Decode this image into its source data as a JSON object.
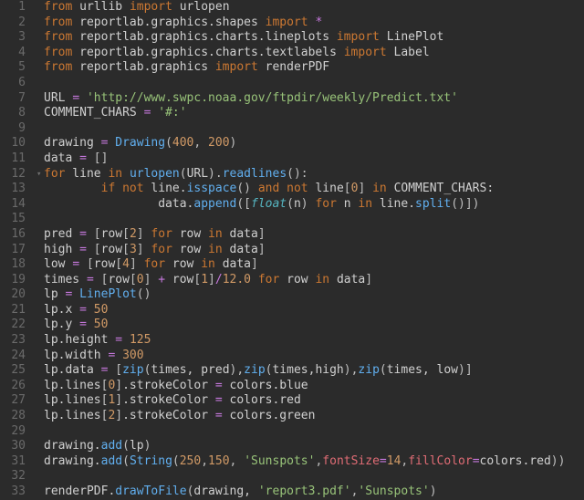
{
  "lines": [
    {
      "n": "1",
      "fold": "",
      "tokens": [
        {
          "c": "kw",
          "t": "from"
        },
        {
          "c": "id",
          "t": " urllib "
        },
        {
          "c": "kw",
          "t": "import"
        },
        {
          "c": "id",
          "t": " urlopen"
        }
      ]
    },
    {
      "n": "2",
      "fold": "",
      "tokens": [
        {
          "c": "kw",
          "t": "from"
        },
        {
          "c": "id",
          "t": " reportlab.graphics.shapes "
        },
        {
          "c": "kw",
          "t": "import"
        },
        {
          "c": "id",
          "t": " "
        },
        {
          "c": "op",
          "t": "*"
        }
      ]
    },
    {
      "n": "3",
      "fold": "",
      "tokens": [
        {
          "c": "kw",
          "t": "from"
        },
        {
          "c": "id",
          "t": " reportlab.graphics.charts.lineplots "
        },
        {
          "c": "kw",
          "t": "import"
        },
        {
          "c": "id",
          "t": " LinePlot"
        }
      ]
    },
    {
      "n": "4",
      "fold": "",
      "tokens": [
        {
          "c": "kw",
          "t": "from"
        },
        {
          "c": "id",
          "t": " reportlab.graphics.charts.textlabels "
        },
        {
          "c": "kw",
          "t": "import"
        },
        {
          "c": "id",
          "t": " Label"
        }
      ]
    },
    {
      "n": "5",
      "fold": "",
      "tokens": [
        {
          "c": "kw",
          "t": "from"
        },
        {
          "c": "id",
          "t": " reportlab.graphics "
        },
        {
          "c": "kw",
          "t": "import"
        },
        {
          "c": "id",
          "t": " renderPDF"
        }
      ]
    },
    {
      "n": "6",
      "fold": "",
      "tokens": [
        {
          "c": "id",
          "t": ""
        }
      ]
    },
    {
      "n": "7",
      "fold": "",
      "tokens": [
        {
          "c": "id",
          "t": "URL "
        },
        {
          "c": "op",
          "t": "="
        },
        {
          "c": "id",
          "t": " "
        },
        {
          "c": "str",
          "t": "'http://www.swpc.noaa.gov/ftpdir/weekly/Predict.txt'"
        }
      ]
    },
    {
      "n": "8",
      "fold": "",
      "tokens": [
        {
          "c": "id",
          "t": "COMMENT_CHARS "
        },
        {
          "c": "op",
          "t": "="
        },
        {
          "c": "id",
          "t": " "
        },
        {
          "c": "str",
          "t": "'#:'"
        }
      ]
    },
    {
      "n": "9",
      "fold": "",
      "tokens": [
        {
          "c": "id",
          "t": ""
        }
      ]
    },
    {
      "n": "10",
      "fold": "",
      "tokens": [
        {
          "c": "id",
          "t": "drawing "
        },
        {
          "c": "op",
          "t": "="
        },
        {
          "c": "id",
          "t": " "
        },
        {
          "c": "fn",
          "t": "Drawing"
        },
        {
          "c": "pun",
          "t": "("
        },
        {
          "c": "num",
          "t": "400"
        },
        {
          "c": "pun",
          "t": ", "
        },
        {
          "c": "num",
          "t": "200"
        },
        {
          "c": "pun",
          "t": ")"
        }
      ]
    },
    {
      "n": "11",
      "fold": "",
      "tokens": [
        {
          "c": "id",
          "t": "data "
        },
        {
          "c": "op",
          "t": "="
        },
        {
          "c": "id",
          "t": " "
        },
        {
          "c": "pun",
          "t": "[]"
        }
      ]
    },
    {
      "n": "12",
      "fold": "▾",
      "tokens": [
        {
          "c": "kw",
          "t": "for"
        },
        {
          "c": "id",
          "t": " line "
        },
        {
          "c": "kw",
          "t": "in"
        },
        {
          "c": "id",
          "t": " "
        },
        {
          "c": "fn",
          "t": "urlopen"
        },
        {
          "c": "pun",
          "t": "("
        },
        {
          "c": "id",
          "t": "URL"
        },
        {
          "c": "pun",
          "t": ")."
        },
        {
          "c": "fn",
          "t": "readlines"
        },
        {
          "c": "pun",
          "t": "():"
        }
      ]
    },
    {
      "n": "13",
      "fold": "",
      "tokens": [
        {
          "c": "id",
          "t": "        "
        },
        {
          "c": "kw",
          "t": "if not"
        },
        {
          "c": "id",
          "t": " line."
        },
        {
          "c": "fn",
          "t": "isspace"
        },
        {
          "c": "pun",
          "t": "()"
        },
        {
          "c": "id",
          "t": " "
        },
        {
          "c": "kw",
          "t": "and not"
        },
        {
          "c": "id",
          "t": " line"
        },
        {
          "c": "pun",
          "t": "["
        },
        {
          "c": "num",
          "t": "0"
        },
        {
          "c": "pun",
          "t": "]"
        },
        {
          "c": "id",
          "t": " "
        },
        {
          "c": "kw",
          "t": "in"
        },
        {
          "c": "id",
          "t": " COMMENT_CHARS:"
        }
      ]
    },
    {
      "n": "14",
      "fold": "",
      "tokens": [
        {
          "c": "id",
          "t": "                data."
        },
        {
          "c": "fn",
          "t": "append"
        },
        {
          "c": "pun",
          "t": "(["
        },
        {
          "c": "fni",
          "t": "float"
        },
        {
          "c": "pun",
          "t": "("
        },
        {
          "c": "id",
          "t": "n"
        },
        {
          "c": "pun",
          "t": ")"
        },
        {
          "c": "id",
          "t": " "
        },
        {
          "c": "kw",
          "t": "for"
        },
        {
          "c": "id",
          "t": " n "
        },
        {
          "c": "kw",
          "t": "in"
        },
        {
          "c": "id",
          "t": " line."
        },
        {
          "c": "fn",
          "t": "split"
        },
        {
          "c": "pun",
          "t": "()])"
        }
      ]
    },
    {
      "n": "15",
      "fold": "",
      "tokens": [
        {
          "c": "id",
          "t": ""
        }
      ]
    },
    {
      "n": "16",
      "fold": "",
      "tokens": [
        {
          "c": "id",
          "t": "pred "
        },
        {
          "c": "op",
          "t": "="
        },
        {
          "c": "id",
          "t": " "
        },
        {
          "c": "pun",
          "t": "["
        },
        {
          "c": "id",
          "t": "row"
        },
        {
          "c": "pun",
          "t": "["
        },
        {
          "c": "num",
          "t": "2"
        },
        {
          "c": "pun",
          "t": "]"
        },
        {
          "c": "id",
          "t": " "
        },
        {
          "c": "kw",
          "t": "for"
        },
        {
          "c": "id",
          "t": " row "
        },
        {
          "c": "kw",
          "t": "in"
        },
        {
          "c": "id",
          "t": " data"
        },
        {
          "c": "pun",
          "t": "]"
        }
      ]
    },
    {
      "n": "17",
      "fold": "",
      "tokens": [
        {
          "c": "id",
          "t": "high "
        },
        {
          "c": "op",
          "t": "="
        },
        {
          "c": "id",
          "t": " "
        },
        {
          "c": "pun",
          "t": "["
        },
        {
          "c": "id",
          "t": "row"
        },
        {
          "c": "pun",
          "t": "["
        },
        {
          "c": "num",
          "t": "3"
        },
        {
          "c": "pun",
          "t": "]"
        },
        {
          "c": "id",
          "t": " "
        },
        {
          "c": "kw",
          "t": "for"
        },
        {
          "c": "id",
          "t": " row "
        },
        {
          "c": "kw",
          "t": "in"
        },
        {
          "c": "id",
          "t": " data"
        },
        {
          "c": "pun",
          "t": "]"
        }
      ]
    },
    {
      "n": "18",
      "fold": "",
      "tokens": [
        {
          "c": "id",
          "t": "low "
        },
        {
          "c": "op",
          "t": "="
        },
        {
          "c": "id",
          "t": " "
        },
        {
          "c": "pun",
          "t": "["
        },
        {
          "c": "id",
          "t": "row"
        },
        {
          "c": "pun",
          "t": "["
        },
        {
          "c": "num",
          "t": "4"
        },
        {
          "c": "pun",
          "t": "]"
        },
        {
          "c": "id",
          "t": " "
        },
        {
          "c": "kw",
          "t": "for"
        },
        {
          "c": "id",
          "t": " row "
        },
        {
          "c": "kw",
          "t": "in"
        },
        {
          "c": "id",
          "t": " data"
        },
        {
          "c": "pun",
          "t": "]"
        }
      ]
    },
    {
      "n": "19",
      "fold": "",
      "tokens": [
        {
          "c": "id",
          "t": "times "
        },
        {
          "c": "op",
          "t": "="
        },
        {
          "c": "id",
          "t": " "
        },
        {
          "c": "pun",
          "t": "["
        },
        {
          "c": "id",
          "t": "row"
        },
        {
          "c": "pun",
          "t": "["
        },
        {
          "c": "num",
          "t": "0"
        },
        {
          "c": "pun",
          "t": "]"
        },
        {
          "c": "id",
          "t": " "
        },
        {
          "c": "op",
          "t": "+"
        },
        {
          "c": "id",
          "t": " row"
        },
        {
          "c": "pun",
          "t": "["
        },
        {
          "c": "num",
          "t": "1"
        },
        {
          "c": "pun",
          "t": "]"
        },
        {
          "c": "op",
          "t": "/"
        },
        {
          "c": "num",
          "t": "12.0"
        },
        {
          "c": "id",
          "t": " "
        },
        {
          "c": "kw",
          "t": "for"
        },
        {
          "c": "id",
          "t": " row "
        },
        {
          "c": "kw",
          "t": "in"
        },
        {
          "c": "id",
          "t": " data"
        },
        {
          "c": "pun",
          "t": "]"
        }
      ]
    },
    {
      "n": "20",
      "fold": "",
      "tokens": [
        {
          "c": "id",
          "t": "lp "
        },
        {
          "c": "op",
          "t": "="
        },
        {
          "c": "id",
          "t": " "
        },
        {
          "c": "fn",
          "t": "LinePlot"
        },
        {
          "c": "pun",
          "t": "()"
        }
      ]
    },
    {
      "n": "21",
      "fold": "",
      "tokens": [
        {
          "c": "id",
          "t": "lp.x "
        },
        {
          "c": "op",
          "t": "="
        },
        {
          "c": "id",
          "t": " "
        },
        {
          "c": "num",
          "t": "50"
        }
      ]
    },
    {
      "n": "22",
      "fold": "",
      "tokens": [
        {
          "c": "id",
          "t": "lp.y "
        },
        {
          "c": "op",
          "t": "="
        },
        {
          "c": "id",
          "t": " "
        },
        {
          "c": "num",
          "t": "50"
        }
      ]
    },
    {
      "n": "23",
      "fold": "",
      "tokens": [
        {
          "c": "id",
          "t": "lp.height "
        },
        {
          "c": "op",
          "t": "="
        },
        {
          "c": "id",
          "t": " "
        },
        {
          "c": "num",
          "t": "125"
        }
      ]
    },
    {
      "n": "24",
      "fold": "",
      "tokens": [
        {
          "c": "id",
          "t": "lp.width "
        },
        {
          "c": "op",
          "t": "="
        },
        {
          "c": "id",
          "t": " "
        },
        {
          "c": "num",
          "t": "300"
        }
      ]
    },
    {
      "n": "25",
      "fold": "",
      "tokens": [
        {
          "c": "id",
          "t": "lp.data "
        },
        {
          "c": "op",
          "t": "="
        },
        {
          "c": "id",
          "t": " "
        },
        {
          "c": "pun",
          "t": "["
        },
        {
          "c": "fn",
          "t": "zip"
        },
        {
          "c": "pun",
          "t": "("
        },
        {
          "c": "id",
          "t": "times, pred"
        },
        {
          "c": "pun",
          "t": "),"
        },
        {
          "c": "fn",
          "t": "zip"
        },
        {
          "c": "pun",
          "t": "("
        },
        {
          "c": "id",
          "t": "times,high"
        },
        {
          "c": "pun",
          "t": "),"
        },
        {
          "c": "fn",
          "t": "zip"
        },
        {
          "c": "pun",
          "t": "("
        },
        {
          "c": "id",
          "t": "times, low"
        },
        {
          "c": "pun",
          "t": ")]"
        }
      ]
    },
    {
      "n": "26",
      "fold": "",
      "tokens": [
        {
          "c": "id",
          "t": "lp.lines"
        },
        {
          "c": "pun",
          "t": "["
        },
        {
          "c": "num",
          "t": "0"
        },
        {
          "c": "pun",
          "t": "]"
        },
        {
          "c": "id",
          "t": ".strokeColor "
        },
        {
          "c": "op",
          "t": "="
        },
        {
          "c": "id",
          "t": " colors.blue"
        }
      ]
    },
    {
      "n": "27",
      "fold": "",
      "tokens": [
        {
          "c": "id",
          "t": "lp.lines"
        },
        {
          "c": "pun",
          "t": "["
        },
        {
          "c": "num",
          "t": "1"
        },
        {
          "c": "pun",
          "t": "]"
        },
        {
          "c": "id",
          "t": ".strokeColor "
        },
        {
          "c": "op",
          "t": "="
        },
        {
          "c": "id",
          "t": " colors.red"
        }
      ]
    },
    {
      "n": "28",
      "fold": "",
      "tokens": [
        {
          "c": "id",
          "t": "lp.lines"
        },
        {
          "c": "pun",
          "t": "["
        },
        {
          "c": "num",
          "t": "2"
        },
        {
          "c": "pun",
          "t": "]"
        },
        {
          "c": "id",
          "t": ".strokeColor "
        },
        {
          "c": "op",
          "t": "="
        },
        {
          "c": "id",
          "t": " colors.green"
        }
      ]
    },
    {
      "n": "29",
      "fold": "",
      "tokens": [
        {
          "c": "id",
          "t": ""
        }
      ]
    },
    {
      "n": "30",
      "fold": "",
      "tokens": [
        {
          "c": "id",
          "t": "drawing."
        },
        {
          "c": "fn",
          "t": "add"
        },
        {
          "c": "pun",
          "t": "("
        },
        {
          "c": "id",
          "t": "lp"
        },
        {
          "c": "pun",
          "t": ")"
        }
      ]
    },
    {
      "n": "31",
      "fold": "",
      "tokens": [
        {
          "c": "id",
          "t": "drawing."
        },
        {
          "c": "fn",
          "t": "add"
        },
        {
          "c": "pun",
          "t": "("
        },
        {
          "c": "fn",
          "t": "String"
        },
        {
          "c": "pun",
          "t": "("
        },
        {
          "c": "num",
          "t": "250"
        },
        {
          "c": "pun",
          "t": ","
        },
        {
          "c": "num",
          "t": "150"
        },
        {
          "c": "pun",
          "t": ", "
        },
        {
          "c": "str",
          "t": "'Sunspots'"
        },
        {
          "c": "pun",
          "t": ","
        },
        {
          "c": "nkw",
          "t": "fontSize"
        },
        {
          "c": "op",
          "t": "="
        },
        {
          "c": "num",
          "t": "14"
        },
        {
          "c": "pun",
          "t": ","
        },
        {
          "c": "nkw",
          "t": "fillColor"
        },
        {
          "c": "op",
          "t": "="
        },
        {
          "c": "id",
          "t": "colors.red"
        },
        {
          "c": "pun",
          "t": "))"
        }
      ]
    },
    {
      "n": "32",
      "fold": "",
      "tokens": [
        {
          "c": "id",
          "t": ""
        }
      ]
    },
    {
      "n": "33",
      "fold": "",
      "tokens": [
        {
          "c": "id",
          "t": "renderPDF."
        },
        {
          "c": "fn",
          "t": "drawToFile"
        },
        {
          "c": "pun",
          "t": "("
        },
        {
          "c": "id",
          "t": "drawing, "
        },
        {
          "c": "str",
          "t": "'report3.pdf'"
        },
        {
          "c": "pun",
          "t": ","
        },
        {
          "c": "str",
          "t": "'Sunspots'"
        },
        {
          "c": "pun",
          "t": ")"
        }
      ]
    }
  ]
}
